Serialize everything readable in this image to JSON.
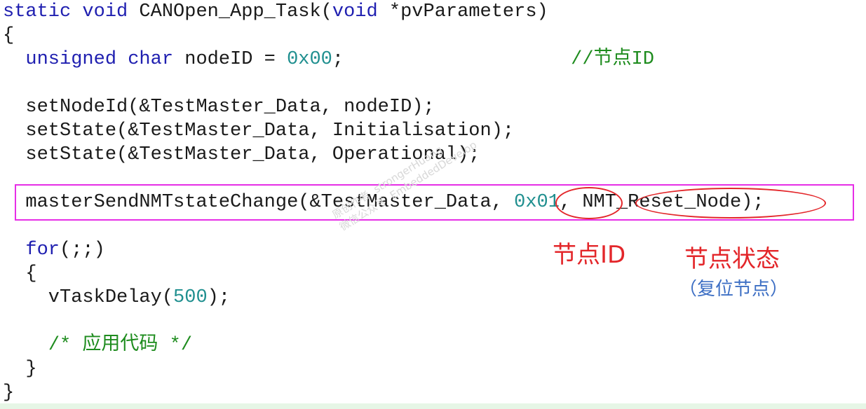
{
  "code": {
    "l1": {
      "kw1": "static",
      "kw2": "void",
      "name": " CANOpen_App_Task(",
      "kw3": "void",
      "rest": " *pvParameters)"
    },
    "l2": "{",
    "l3": {
      "indent": "  ",
      "kw1": "unsigned",
      "kw2": "char",
      "mid": " nodeID = ",
      "num": "0x00",
      "semi": ";",
      "pad": "                    ",
      "comment": "//节点ID"
    },
    "l4": "  setNodeId(&TestMaster_Data, nodeID);",
    "l5": "  setState(&TestMaster_Data, Initialisation);",
    "l6": "  setState(&TestMaster_Data, Operational);",
    "l7": {
      "pre": "  masterSendNMTstateChange(&TestMaster_Data, ",
      "num": "0x01",
      "post": ", NMT_Reset_Node);"
    },
    "l8": {
      "indent": "  ",
      "kw": "for",
      "rest": "(;;)"
    },
    "l9": "  {",
    "l10": {
      "pre": "    vTaskDelay(",
      "num": "500",
      "post": ");"
    },
    "l11": {
      "indent": "    ",
      "comment": "/* 应用代码 */"
    },
    "l12": "  }",
    "l13": "}"
  },
  "annotations": {
    "node_id": "节点ID",
    "node_state": "节点状态",
    "reset_node": "（复位节点）"
  },
  "watermark": {
    "line1": "原创作者  strongerHuang",
    "line2": "微信公众号  EmbeddedDevelop"
  },
  "colors": {
    "keyword": "#1f1fb0",
    "number": "#1f8f8f",
    "comment": "#1e8c1e",
    "highlight_box": "#e62ee6",
    "annotation_red": "#e3262a",
    "annotation_blue": "#3d6fc4"
  }
}
